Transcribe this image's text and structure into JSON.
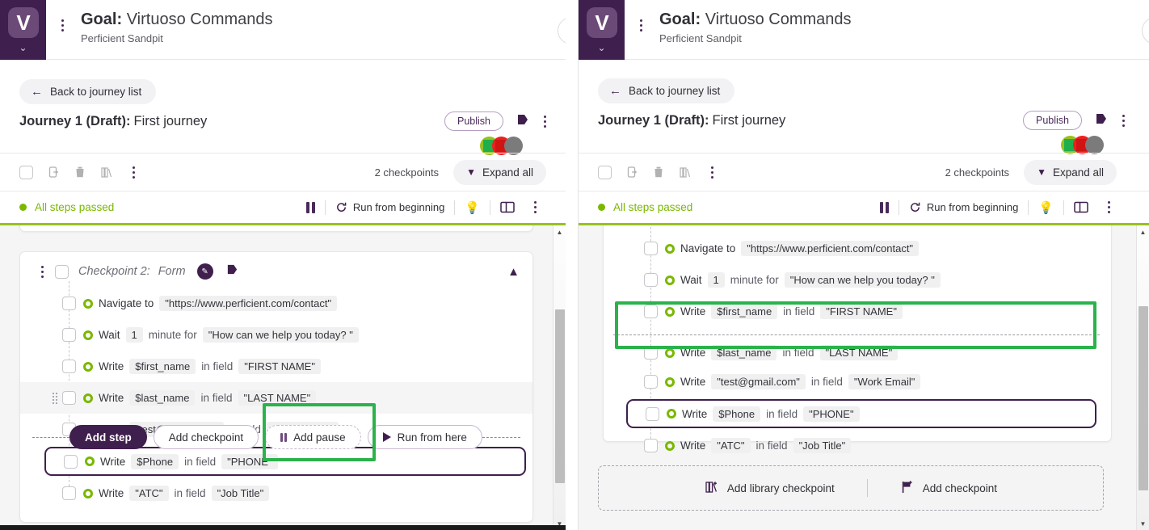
{
  "app": {
    "logo_letter": "V",
    "logo_caret": "⌄",
    "goal_label": "Goal:",
    "goal_name": "Virtuoso Commands",
    "org": "Perficient Sandpit"
  },
  "journey": {
    "back_label": "Back to journey list",
    "title_prefix": "Journey 1 (Draft):",
    "title_name": "First journey",
    "publish_label": "Publish"
  },
  "selectbar": {
    "checkpoints_count": "2 checkpoints",
    "expand_label": "Expand all"
  },
  "runbar": {
    "status": "All steps passed",
    "run_label": "Run from beginning"
  },
  "checkpoint": {
    "label": "Checkpoint 2:",
    "name": "Form"
  },
  "steps": [
    {
      "verb": "Navigate to",
      "chip1": "\"https://www.perficient.com/contact\"",
      "mid": "",
      "chip2": ""
    },
    {
      "verb": "Wait",
      "chip1": "1",
      "mid": "minute for",
      "chip2": "\"How can we help you today? \""
    },
    {
      "verb": "Write",
      "chip1": "$first_name",
      "mid": "in field",
      "chip2": "\"FIRST NAME\""
    },
    {
      "verb": "Write",
      "chip1": "$last_name",
      "mid": "in field",
      "chip2": "\"LAST NAME\""
    },
    {
      "verb": "Write",
      "chip1": "\"test@gmail.com\"",
      "mid": "in field",
      "chip2": "\"Work Email\""
    },
    {
      "verb": "Write",
      "chip1": "$Phone",
      "mid": "in field",
      "chip2": "\"PHONE\""
    },
    {
      "verb": "Write",
      "chip1": "\"ATC\"",
      "mid": "in field",
      "chip2": "\"Job Title\""
    }
  ],
  "popup": {
    "add_step": "Add step",
    "add_checkpoint": "Add checkpoint",
    "add_pause": "Add pause",
    "run_from_here": "Run from here"
  },
  "footer": {
    "add_library_checkpoint": "Add library checkpoint",
    "add_checkpoint": "Add checkpoint"
  },
  "colors": {
    "brand_purple": "#3f1f4d",
    "accent_green": "#97c11f",
    "pass_green": "#7ab800",
    "highlight_green": "#2bb24c",
    "status_red": "#ef1f1f",
    "status_grey": "#7b7b7b"
  }
}
